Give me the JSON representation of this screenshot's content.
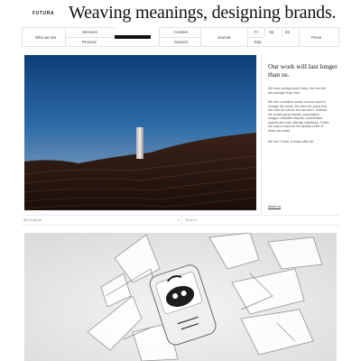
{
  "brand": {
    "logo": "FUTURA",
    "tagline": "Weaving meanings, designing brands."
  },
  "nav": {
    "who_we_are": "Who we are",
    "services": "Services",
    "process": "Process",
    "contact": "Contact",
    "careers": "Careers",
    "journal": "Journal",
    "lang_fr": "Fr",
    "lang_sp": "Sp",
    "lang_en": "En",
    "lang_esp": "Esp",
    "press": "Press"
  },
  "intro": {
    "title": "Our work will last longer than us.",
    "p1": "We have always been frank, but now we are stronger than ever.",
    "p2": "We are a creative studio and we want to change the world. We wish we could find the cure for cancer but we won't. Instead we create great brands, provocative images, beautiful objects, comfortable spaces and user-friendly interfaces. That's our way to improve the quality of life of those we reach.",
    "p3": "We are Futura, a brand after all.",
    "link": "About us"
  },
  "filters": {
    "category": "All Projects",
    "search_placeholder": "Search"
  },
  "colors": {
    "accent": "#111111",
    "border": "#e2e2e2"
  }
}
